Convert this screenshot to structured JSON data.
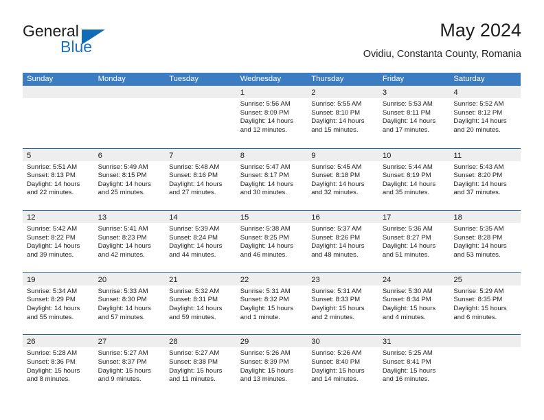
{
  "brand": {
    "name_part1": "General",
    "name_part2": "Blue",
    "accent_color": "#0f6cb5"
  },
  "header": {
    "title": "May 2024",
    "subtitle": "Ovidiu, Constanta County, Romania"
  },
  "theme": {
    "header_row_bg": "#3c7cc0",
    "week_border": "#21619f",
    "day_strip_bg": "#eeeeee",
    "text": "#1c1c1c"
  },
  "calendar": {
    "weekday_headers": [
      "Sunday",
      "Monday",
      "Tuesday",
      "Wednesday",
      "Thursday",
      "Friday",
      "Saturday"
    ],
    "weeks": [
      [
        {
          "day": "",
          "lines": []
        },
        {
          "day": "",
          "lines": []
        },
        {
          "day": "",
          "lines": []
        },
        {
          "day": "1",
          "lines": [
            "Sunrise: 5:56 AM",
            "Sunset: 8:09 PM",
            "Daylight: 14 hours",
            "and 12 minutes."
          ]
        },
        {
          "day": "2",
          "lines": [
            "Sunrise: 5:55 AM",
            "Sunset: 8:10 PM",
            "Daylight: 14 hours",
            "and 15 minutes."
          ]
        },
        {
          "day": "3",
          "lines": [
            "Sunrise: 5:53 AM",
            "Sunset: 8:11 PM",
            "Daylight: 14 hours",
            "and 17 minutes."
          ]
        },
        {
          "day": "4",
          "lines": [
            "Sunrise: 5:52 AM",
            "Sunset: 8:12 PM",
            "Daylight: 14 hours",
            "and 20 minutes."
          ]
        }
      ],
      [
        {
          "day": "5",
          "lines": [
            "Sunrise: 5:51 AM",
            "Sunset: 8:13 PM",
            "Daylight: 14 hours",
            "and 22 minutes."
          ]
        },
        {
          "day": "6",
          "lines": [
            "Sunrise: 5:49 AM",
            "Sunset: 8:15 PM",
            "Daylight: 14 hours",
            "and 25 minutes."
          ]
        },
        {
          "day": "7",
          "lines": [
            "Sunrise: 5:48 AM",
            "Sunset: 8:16 PM",
            "Daylight: 14 hours",
            "and 27 minutes."
          ]
        },
        {
          "day": "8",
          "lines": [
            "Sunrise: 5:47 AM",
            "Sunset: 8:17 PM",
            "Daylight: 14 hours",
            "and 30 minutes."
          ]
        },
        {
          "day": "9",
          "lines": [
            "Sunrise: 5:45 AM",
            "Sunset: 8:18 PM",
            "Daylight: 14 hours",
            "and 32 minutes."
          ]
        },
        {
          "day": "10",
          "lines": [
            "Sunrise: 5:44 AM",
            "Sunset: 8:19 PM",
            "Daylight: 14 hours",
            "and 35 minutes."
          ]
        },
        {
          "day": "11",
          "lines": [
            "Sunrise: 5:43 AM",
            "Sunset: 8:20 PM",
            "Daylight: 14 hours",
            "and 37 minutes."
          ]
        }
      ],
      [
        {
          "day": "12",
          "lines": [
            "Sunrise: 5:42 AM",
            "Sunset: 8:22 PM",
            "Daylight: 14 hours",
            "and 39 minutes."
          ]
        },
        {
          "day": "13",
          "lines": [
            "Sunrise: 5:41 AM",
            "Sunset: 8:23 PM",
            "Daylight: 14 hours",
            "and 42 minutes."
          ]
        },
        {
          "day": "14",
          "lines": [
            "Sunrise: 5:39 AM",
            "Sunset: 8:24 PM",
            "Daylight: 14 hours",
            "and 44 minutes."
          ]
        },
        {
          "day": "15",
          "lines": [
            "Sunrise: 5:38 AM",
            "Sunset: 8:25 PM",
            "Daylight: 14 hours",
            "and 46 minutes."
          ]
        },
        {
          "day": "16",
          "lines": [
            "Sunrise: 5:37 AM",
            "Sunset: 8:26 PM",
            "Daylight: 14 hours",
            "and 48 minutes."
          ]
        },
        {
          "day": "17",
          "lines": [
            "Sunrise: 5:36 AM",
            "Sunset: 8:27 PM",
            "Daylight: 14 hours",
            "and 51 minutes."
          ]
        },
        {
          "day": "18",
          "lines": [
            "Sunrise: 5:35 AM",
            "Sunset: 8:28 PM",
            "Daylight: 14 hours",
            "and 53 minutes."
          ]
        }
      ],
      [
        {
          "day": "19",
          "lines": [
            "Sunrise: 5:34 AM",
            "Sunset: 8:29 PM",
            "Daylight: 14 hours",
            "and 55 minutes."
          ]
        },
        {
          "day": "20",
          "lines": [
            "Sunrise: 5:33 AM",
            "Sunset: 8:30 PM",
            "Daylight: 14 hours",
            "and 57 minutes."
          ]
        },
        {
          "day": "21",
          "lines": [
            "Sunrise: 5:32 AM",
            "Sunset: 8:31 PM",
            "Daylight: 14 hours",
            "and 59 minutes."
          ]
        },
        {
          "day": "22",
          "lines": [
            "Sunrise: 5:31 AM",
            "Sunset: 8:32 PM",
            "Daylight: 15 hours",
            "and 1 minute."
          ]
        },
        {
          "day": "23",
          "lines": [
            "Sunrise: 5:31 AM",
            "Sunset: 8:33 PM",
            "Daylight: 15 hours",
            "and 2 minutes."
          ]
        },
        {
          "day": "24",
          "lines": [
            "Sunrise: 5:30 AM",
            "Sunset: 8:34 PM",
            "Daylight: 15 hours",
            "and 4 minutes."
          ]
        },
        {
          "day": "25",
          "lines": [
            "Sunrise: 5:29 AM",
            "Sunset: 8:35 PM",
            "Daylight: 15 hours",
            "and 6 minutes."
          ]
        }
      ],
      [
        {
          "day": "26",
          "lines": [
            "Sunrise: 5:28 AM",
            "Sunset: 8:36 PM",
            "Daylight: 15 hours",
            "and 8 minutes."
          ]
        },
        {
          "day": "27",
          "lines": [
            "Sunrise: 5:27 AM",
            "Sunset: 8:37 PM",
            "Daylight: 15 hours",
            "and 9 minutes."
          ]
        },
        {
          "day": "28",
          "lines": [
            "Sunrise: 5:27 AM",
            "Sunset: 8:38 PM",
            "Daylight: 15 hours",
            "and 11 minutes."
          ]
        },
        {
          "day": "29",
          "lines": [
            "Sunrise: 5:26 AM",
            "Sunset: 8:39 PM",
            "Daylight: 15 hours",
            "and 13 minutes."
          ]
        },
        {
          "day": "30",
          "lines": [
            "Sunrise: 5:26 AM",
            "Sunset: 8:40 PM",
            "Daylight: 15 hours",
            "and 14 minutes."
          ]
        },
        {
          "day": "31",
          "lines": [
            "Sunrise: 5:25 AM",
            "Sunset: 8:41 PM",
            "Daylight: 15 hours",
            "and 16 minutes."
          ]
        },
        {
          "day": "",
          "lines": []
        }
      ]
    ]
  }
}
